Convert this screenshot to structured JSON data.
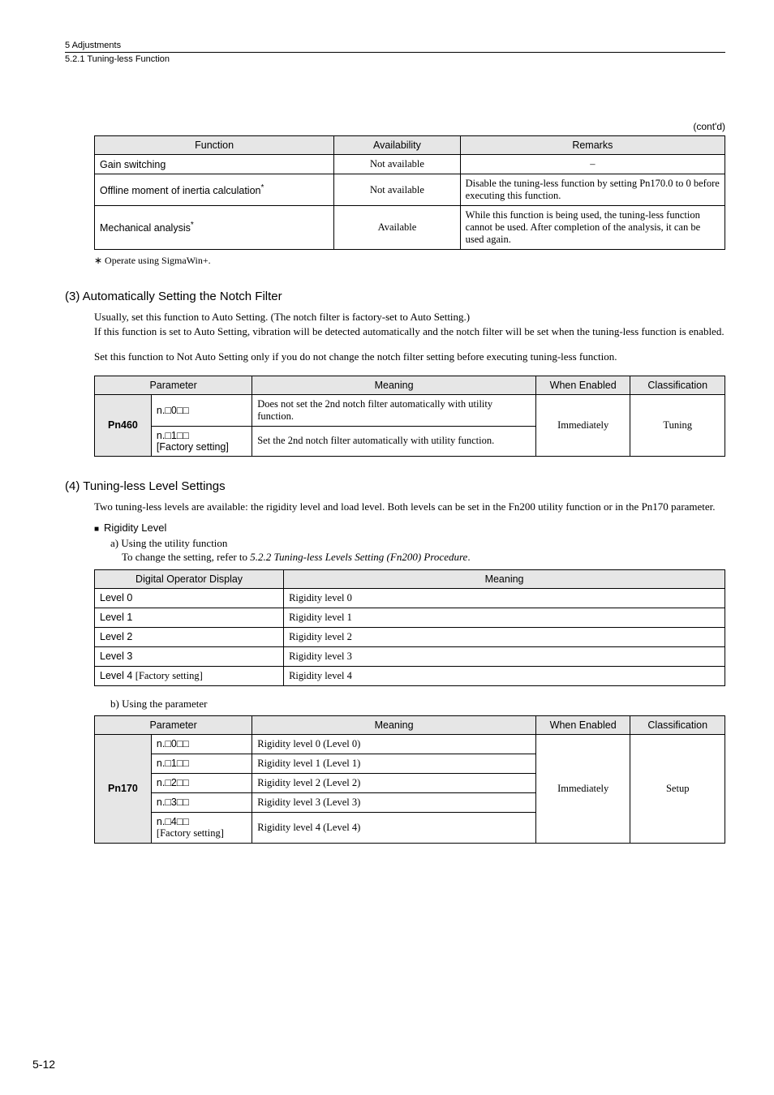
{
  "header": {
    "chapter": "5  Adjustments",
    "subsection": "5.2.1  Tuning-less Function"
  },
  "contd_label": "(cont'd)",
  "table1": {
    "headers": {
      "c1": "Function",
      "c2": "Availability",
      "c3": "Remarks"
    },
    "rows": [
      {
        "c1": "Gain switching",
        "c2": "Not available",
        "c3": "–"
      },
      {
        "c1": "Offline moment of inertia calculation",
        "c1star": "*",
        "c2": "Not available",
        "c3": "Disable the tuning-less function by setting Pn170.0 to 0 before executing this function."
      },
      {
        "c1": "Mechanical analysis",
        "c1star": "*",
        "c2": "Available",
        "c3": "While this function is being used, the tuning-less function cannot be used. After completion of the analysis, it can be used again."
      }
    ]
  },
  "footnote1": "∗    Operate using SigmaWin+.",
  "section3": {
    "title": "(3)   Automatically Setting the Notch Filter",
    "p1": "Usually, set this function to Auto Setting. (The notch filter is factory-set to Auto Setting.)",
    "p2": "If this function is set to Auto Setting, vibration will be detected automatically and the notch filter will be set when the tuning-less function is enabled.",
    "p3": "Set this function to Not Auto Setting only if you do not change the notch filter setting before executing tuning-less function."
  },
  "table2": {
    "headers": {
      "c1": "Parameter",
      "c2": "Meaning",
      "c3": "When Enabled",
      "c4": "Classification"
    },
    "param": "Pn460",
    "row1": {
      "val": "n.□0□□",
      "meaning": "Does not set the 2nd notch filter automatically with utility function."
    },
    "row2": {
      "val": "n.□1□□",
      "factory": "[Factory setting]",
      "meaning": "Set the 2nd notch filter automatically with utility function."
    },
    "when": "Immediately",
    "cls": "Tuning"
  },
  "section4": {
    "title": "(4)   Tuning-less Level Settings",
    "p1": "Two tuning-less levels are available: the rigidity level and load level. Both levels can be set in the Fn200 utility function or in the Pn170 parameter.",
    "rigidity_label": "Rigidity Level",
    "a_label": "a) Using the utility function",
    "a_text_prefix": "To change the setting, refer to ",
    "a_text_italic": "5.2.2  Tuning-less Levels Setting (Fn200) Procedure",
    "a_text_suffix": "."
  },
  "table3": {
    "headers": {
      "c1": "Digital Operator Display",
      "c2": "Meaning"
    },
    "rows": [
      {
        "c1": "Level 0",
        "c2": "Rigidity level 0"
      },
      {
        "c1": "Level 1",
        "c2": "Rigidity level 1"
      },
      {
        "c1": "Level 2",
        "c2": "Rigidity level 2"
      },
      {
        "c1": "Level 3",
        "c2": "Rigidity level 3"
      },
      {
        "c1_prefix": "Level 4 ",
        "c1_suffix": "[Factory setting]",
        "c2": "Rigidity level 4"
      }
    ]
  },
  "b_label": "b) Using the parameter",
  "table4": {
    "headers": {
      "c1": "Parameter",
      "c2": "Meaning",
      "c3": "When Enabled",
      "c4": "Classification"
    },
    "param": "Pn170",
    "rows": [
      {
        "val": "n.□0□□",
        "meaning": "Rigidity level 0 (Level 0)"
      },
      {
        "val": "n.□1□□",
        "meaning": "Rigidity level 1 (Level 1)"
      },
      {
        "val": "n.□2□□",
        "meaning": "Rigidity level 2 (Level 2)"
      },
      {
        "val": "n.□3□□",
        "meaning": "Rigidity level 3 (Level 3)"
      },
      {
        "val": "n.□4□□",
        "factory": "[Factory setting]",
        "meaning": "Rigidity level 4 (Level 4)"
      }
    ],
    "when": "Immediately",
    "cls": "Setup"
  },
  "page_num": "5-12"
}
